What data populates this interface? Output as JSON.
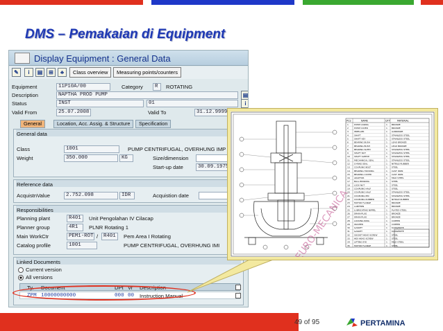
{
  "slide": {
    "title": "DMS – Pemakaian di Equipment",
    "page": "49 of 95",
    "brand": "PERTAMINA",
    "bar_colors": [
      "#e0301e",
      "#1e38c8",
      "#3aa830"
    ]
  },
  "sap": {
    "window_title": "Display Equipment : General Data",
    "toolbar": {
      "class_overview": "Class overview",
      "measuring_points": "Measuring points/counters"
    },
    "header_fields": {
      "equipment_label": "Equipment",
      "equipment_value": "11P10A/00",
      "category_label": "Category",
      "category_value": "R",
      "category_text": "ROTATING",
      "description_label": "Description",
      "description_value": "NAPTHA PROD PUMP",
      "status_label": "Status",
      "status_value": "INST",
      "status_value2": "01",
      "valid_from_label": "Valid From",
      "valid_from_value": "25.07.2008",
      "valid_to_label": "Valid To",
      "valid_to_value": "31.12.9999"
    },
    "tabs": [
      "General",
      "Location, Acc. Assig. & Structure",
      "Specification"
    ],
    "general_data": {
      "title": "General data",
      "class_label": "Class",
      "class_value": "1001",
      "class_text": "PUMP CENTRIFUGAL, OVERHUNG IMP",
      "weight_label": "Weight",
      "weight_value": "350.000",
      "weight_unit": "KG",
      "size_label": "Size/dimension",
      "startup_label": "Start-up date",
      "startup_value": "30.09.1975"
    },
    "reference_data": {
      "title": "Reference data",
      "acq_value_label": "AcquistnValue",
      "acq_value": "2.752.098",
      "acq_currency": "IDR",
      "acq_date_label": "Acquistion date"
    },
    "responsibilities": {
      "title": "Responsibilities",
      "planning_plant_label": "Planning plant",
      "planning_plant_value": "R401",
      "planning_plant_text": "Unit Pengolahan IV Cilacap",
      "planner_group_label": "Planner group",
      "planner_group_value": "4R1",
      "planner_group_text": "PLNR Rotating 1",
      "main_workctr_label": "Main WorkCtr",
      "main_workctr_value": "PEM1-ROT",
      "main_workctr_sep": "/",
      "main_workctr_plant": "R401",
      "main_workctr_text": "Pem Area I Rotating",
      "catalog_label": "Catalog profile",
      "catalog_value": "1001",
      "catalog_text": "PUMP CENTRIFUGAL, OVERHUNG IMI"
    },
    "linked_docs": {
      "title": "Linked Documents",
      "current_version": "Current version",
      "all_versions": "All versions",
      "columns": [
        "Ty.",
        "Document",
        "DPt",
        "Vr",
        "Description"
      ],
      "rows": [
        {
          "type": "ZPM",
          "document": "10000000000",
          "dpt": "000",
          "vr": "00",
          "description": "Instruction Manual"
        }
      ]
    }
  },
  "drawing": {
    "watermark": "EURO-MECANICA",
    "table_headers": [
      "PCS",
      "NAME",
      "QTY",
      "MATERIAL"
    ],
    "parts": [
      {
        "no": "1",
        "name": "PUMP CASING",
        "mat": "BRONZE"
      },
      {
        "no": "2",
        "name": "PUMP COVER",
        "mat": "BRONZE"
      },
      {
        "no": "3",
        "name": "IMPELLER",
        "mat": "ALBRONZE"
      },
      {
        "no": "4",
        "name": "SHAFT",
        "mat": "STAINLESS STEEL"
      },
      {
        "no": "5",
        "name": "SHAFT KEY",
        "mat": "STAINLESS STEEL"
      },
      {
        "no": "6",
        "name": "BEARING BUSH",
        "mat": "LEAD BRONZE"
      },
      {
        "no": "7",
        "name": "BEARING BUSH",
        "mat": "LEAD BRONZE"
      },
      {
        "no": "8",
        "name": "BEARING SLEEV",
        "mat": "STAINLESS STEEL"
      },
      {
        "no": "9",
        "name": "SHAFT NUT",
        "mat": "STAINLESS STEEL"
      },
      {
        "no": "10",
        "name": "SHAFT SLEEVE",
        "mat": "STAINLESS STEEL"
      },
      {
        "no": "11",
        "name": "MECHANICAL SEAL",
        "mat": "STAINLESS STEEL"
      },
      {
        "no": "12",
        "name": "O-RING SEAL",
        "mat": "NITRILE RUBBER"
      },
      {
        "no": "13",
        "name": "COUPLING BOLT",
        "mat": "STEEL"
      },
      {
        "no": "14",
        "name": "BEARING HOUSING",
        "mat": "CAST IRON"
      },
      {
        "no": "15",
        "name": "BEARING COVER",
        "mat": "CAST IRON"
      },
      {
        "no": "16",
        "name": "ADAPTOR",
        "mat": "MILD STEEL"
      },
      {
        "no": "17",
        "name": "BALL BEARING",
        "mat": "STEEL"
      },
      {
        "no": "18",
        "name": "LOCK NUT",
        "mat": "STEEL"
      },
      {
        "no": "19",
        "name": "COUPLING HALF",
        "mat": "STEEL"
      },
      {
        "no": "20",
        "name": "COUPLING HALF",
        "mat": "STAINLESS STEEL"
      },
      {
        "no": "21",
        "name": "COUPLING PIN",
        "mat": "STAINLESS STEEL"
      },
      {
        "no": "22",
        "name": "COUPLING RUBBER",
        "mat": "NITRILE RUBBER"
      },
      {
        "no": "23",
        "name": "MOTOR FLANGE",
        "mat": "BRONZE"
      },
      {
        "no": "24",
        "name": "LANTERN",
        "mat": "BRONZE"
      },
      {
        "no": "25",
        "name": "LUBRICATING NIPPEL",
        "mat": "PLATED STEEL"
      },
      {
        "no": "26",
        "name": "DRAIN PLUG",
        "mat": "BRONZE"
      },
      {
        "no": "27",
        "name": "DRAIN PLUG",
        "mat": "BRONZE"
      },
      {
        "no": "28",
        "name": "LOCKING RING",
        "mat": "COPPER"
      },
      {
        "no": "29",
        "name": "WASHER",
        "mat": "COPPER"
      },
      {
        "no": "30",
        "name": "GASKET",
        "mat": "KLINGERITE"
      },
      {
        "no": "31",
        "name": "GASKET",
        "mat": "KLINGERITE"
      },
      {
        "no": "32",
        "name": "SOCKET HEAD SCREW",
        "mat": "STEEL"
      },
      {
        "no": "33",
        "name": "HEX HEAD SCREW",
        "mat": "STEEL"
      },
      {
        "no": "34",
        "name": "LIFTING EYE",
        "mat": "MILD STEEL"
      },
      {
        "no": "35",
        "name": "MOTOR FLANGE",
        "mat": "STEEL"
      }
    ]
  }
}
